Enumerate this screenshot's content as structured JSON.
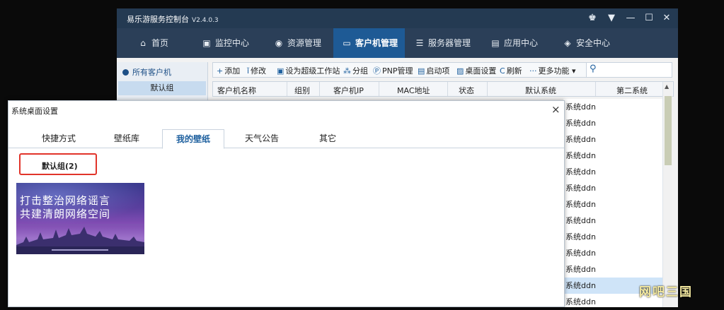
{
  "app": {
    "title": "易乐游服务控制台",
    "version": "V2.4.0.3"
  },
  "nav": [
    {
      "label": "首页",
      "icon": "home-icon",
      "glyph": "⌂"
    },
    {
      "label": "监控中心",
      "icon": "monitor-icon",
      "glyph": "▣"
    },
    {
      "label": "资源管理",
      "icon": "gamepad-icon",
      "glyph": "◉"
    },
    {
      "label": "客户机管理",
      "icon": "display-icon",
      "glyph": "▭"
    },
    {
      "label": "服务器管理",
      "icon": "server-icon",
      "glyph": "☰"
    },
    {
      "label": "应用中心",
      "icon": "briefcase-icon",
      "glyph": "▤"
    },
    {
      "label": "安全中心",
      "icon": "shield-icon",
      "glyph": "◈"
    }
  ],
  "sidebar": {
    "all_clients": "所有客户机",
    "default_group": "默认组"
  },
  "toolbar": [
    {
      "label": "添加",
      "glyph": "+"
    },
    {
      "label": "修改",
      "glyph": "ǐ"
    },
    {
      "label": "设为超级工作站",
      "glyph": "▣"
    },
    {
      "label": "分组",
      "glyph": "⁂"
    },
    {
      "label": "PNP管理",
      "glyph": "Ⓟ"
    },
    {
      "label": "启动项",
      "glyph": "▤"
    },
    {
      "label": "桌面设置",
      "glyph": "▨"
    },
    {
      "label": "刷新",
      "glyph": "C"
    },
    {
      "label": "更多功能",
      "glyph": "···"
    }
  ],
  "table": {
    "headers": [
      "客户机名称",
      "组别",
      "客户机IP",
      "MAC地址",
      "状态",
      "默认系统",
      "第二系统"
    ],
    "visible_default_system": [
      "系统ddn",
      "系统ddn",
      "系统ddn",
      "系统ddn",
      "系统ddn",
      "系统ddn",
      "系统ddn",
      "系统ddn",
      "系统ddn",
      "系统ddn",
      "系统ddn",
      "系统ddn",
      "系统ddn"
    ],
    "selected_row_index": 11
  },
  "dialog": {
    "title": "系统桌面设置",
    "tabs": [
      "快捷方式",
      "壁纸库",
      "我的壁纸",
      "天气公告",
      "其它"
    ],
    "active_tab": 2,
    "group_label": "默认组(2)",
    "wallpaper": {
      "line1": "打击整治网络谣言",
      "line2": "共建清朗网络空间"
    }
  },
  "watermark": "网吧三国",
  "colors": {
    "titlebar": "#243a52",
    "nav_active": "#1e5a95",
    "accent": "#1d5f9e",
    "highlight_box": "#e1342a"
  }
}
